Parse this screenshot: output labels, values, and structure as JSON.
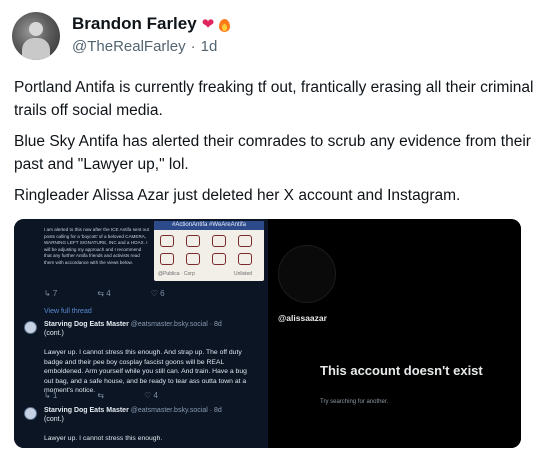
{
  "author": {
    "display_name": "Brandon Farley",
    "emoji_heart": "❤",
    "emoji_fire": "fire-emoji",
    "handle": "@TheRealFarley",
    "separator": "·",
    "time": "1d"
  },
  "post": {
    "paragraphs": [
      "Portland Antifa is currently freaking tf out, frantically erasing all their criminal trails off social media.",
      "Blue Sky Antifa has alerted their comrades to scrub any evidence from their past and \"Lawyer up,\" lol.",
      "Ringleader Alissa Azar just deleted her X account and Instagram."
    ]
  },
  "media_left": {
    "image_text": "I am alerted to this now after the ICE Antifa sent out posts calling for a 'boycott' of a beloved CAMERA, WARNING LEFT SIGNATURE, INC and a HOAX. I will be adjusting my approach and I recommend that any further Antifa friends and activists read them with accordance with the views below.",
    "image_caption": "#ActionAntifa #WeAreAntifa",
    "meta_left": "@Publica · Corp",
    "meta_right": "Unlisted",
    "post_actions": [
      "↳ 7",
      "⇆ 4",
      "♡ 6"
    ],
    "view_full_thread": "View full thread",
    "reply1": {
      "name": "Starving Dog Eats Master",
      "handle": "@eatsmaster.bsky.social · 8d",
      "cont": "(cont.)",
      "text": "Lawyer up. I cannot stress this enough. And strap up. The off duty badge and their pee boy cosplay fascist goons will be REAL emboldened. Arm yourself while you still can. And train. Have a bug out bag, and a safe house, and be ready to tear ass outta town at a moment's notice."
    },
    "reply1_actions": [
      "↳ 1",
      "⇆",
      "♡ 4"
    ],
    "reply2": {
      "name": "Starving Dog Eats Master",
      "handle": "@eatsmaster.bsky.social · 8d",
      "cont": "(cont.)",
      "text": "Lawyer up. I cannot stress this enough."
    }
  },
  "media_right": {
    "handle": "@alissaazar",
    "message": "This account doesn't exist",
    "subtext": "Try searching for another."
  }
}
